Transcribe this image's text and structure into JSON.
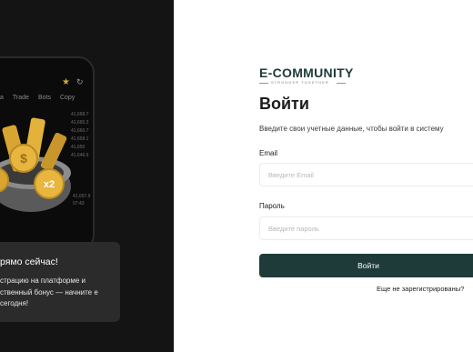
{
  "promo": {
    "phone_nav": [
      "a",
      "Trade",
      "Bots",
      "Copy"
    ],
    "tick_values": [
      "41,668.7",
      "41,665.3",
      "41,660.7",
      "41,658.1",
      "41,650",
      "41,646.6"
    ],
    "tick_values_lower": [
      "41,657.9",
      "07:43"
    ],
    "title": "рямо сейчас!",
    "text": "страцию на платформе и ственный бонус — начните е сегодня!"
  },
  "logo": {
    "name": "E-COMMUNITY",
    "tagline": "STRONGER TOGETHER"
  },
  "login": {
    "title": "Войти",
    "subtitle": "Введите свои учетные данные, чтобы войти в систему",
    "email_label": "Email",
    "email_placeholder": "Введите Email",
    "password_label": "Пароль",
    "password_placeholder": "Введите пароль",
    "submit_label": "Войти",
    "register_link": "Еще не зарегистрированы?"
  },
  "colors": {
    "brand": "#1f3b39",
    "left_panel": "#141414",
    "coin_gold": "#d9a531"
  }
}
